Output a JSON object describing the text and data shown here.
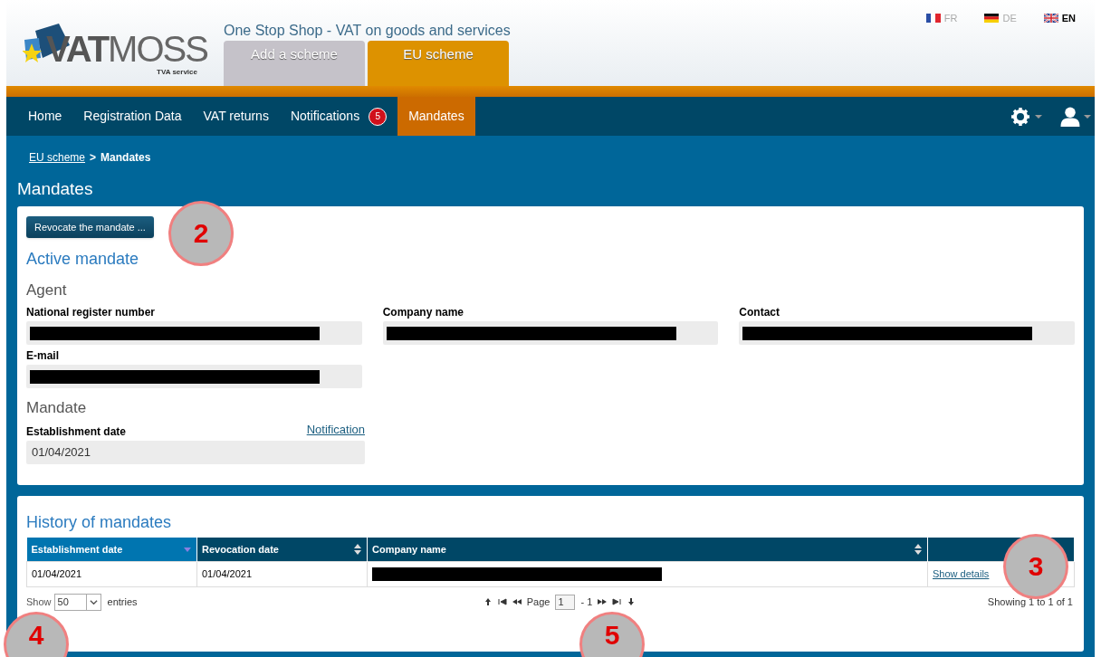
{
  "header": {
    "site_title": "One Stop Shop - VAT on goods and services",
    "logo": {
      "wordmark_bold": "VAT",
      "wordmark_light": "MOSS",
      "tagline": "TVA service"
    },
    "scheme_tabs": [
      {
        "label": "Add a scheme",
        "selected": false
      },
      {
        "label": "EU scheme",
        "selected": true
      }
    ],
    "languages": [
      {
        "code": "FR",
        "selected": false
      },
      {
        "code": "DE",
        "selected": false
      },
      {
        "code": "EN",
        "selected": true
      }
    ]
  },
  "nav": {
    "items": [
      {
        "label": "Home",
        "selected": false
      },
      {
        "label": "Registration Data",
        "selected": false
      },
      {
        "label": "VAT returns",
        "selected": false
      },
      {
        "label": "Notifications",
        "badge": "5",
        "selected": false
      },
      {
        "label": "Mandates",
        "selected": true
      }
    ]
  },
  "breadcrumb": {
    "link": "EU scheme",
    "separator": ">",
    "current": "Mandates"
  },
  "page_title": "Mandates",
  "active_mandate": {
    "button": "Revocate the mandate ...",
    "title": "Active mandate",
    "agent": {
      "heading": "Agent",
      "fields": [
        {
          "label": "National register number",
          "redacted": true
        },
        {
          "label": "Company name",
          "redacted": true
        },
        {
          "label": "Contact",
          "redacted": true
        },
        {
          "label": "E-mail",
          "redacted": true
        }
      ]
    },
    "mandate": {
      "heading": "Mandate",
      "field": {
        "label": "Establishment date",
        "link": "Notification",
        "value": "01/04/2021"
      }
    }
  },
  "history": {
    "title": "History of mandates",
    "table": {
      "columns": [
        {
          "label": "Establishment date",
          "kind": "sorted"
        },
        {
          "label": "Revocation date",
          "kind": "sortable"
        },
        {
          "label": "Company name",
          "kind": "sortable"
        },
        {
          "kind": "plain"
        }
      ],
      "rows": [
        {
          "cells": [
            {
              "kind": "text",
              "text": "01/04/2021"
            },
            {
              "kind": "text",
              "text": "01/04/2021"
            },
            {
              "kind": "redacted"
            },
            {
              "kind": "link",
              "text": "Show details"
            }
          ]
        }
      ]
    },
    "footer": {
      "show_label": "Show",
      "page_size": "50",
      "entries_label": "entries",
      "page_label": "Page",
      "page": "1",
      "page_count": "- 1",
      "summary": "Showing 1 to 1 of 1"
    }
  },
  "annotations": [
    {
      "number": "2"
    },
    {
      "number": "3"
    },
    {
      "number": "4"
    },
    {
      "number": "5"
    }
  ]
}
